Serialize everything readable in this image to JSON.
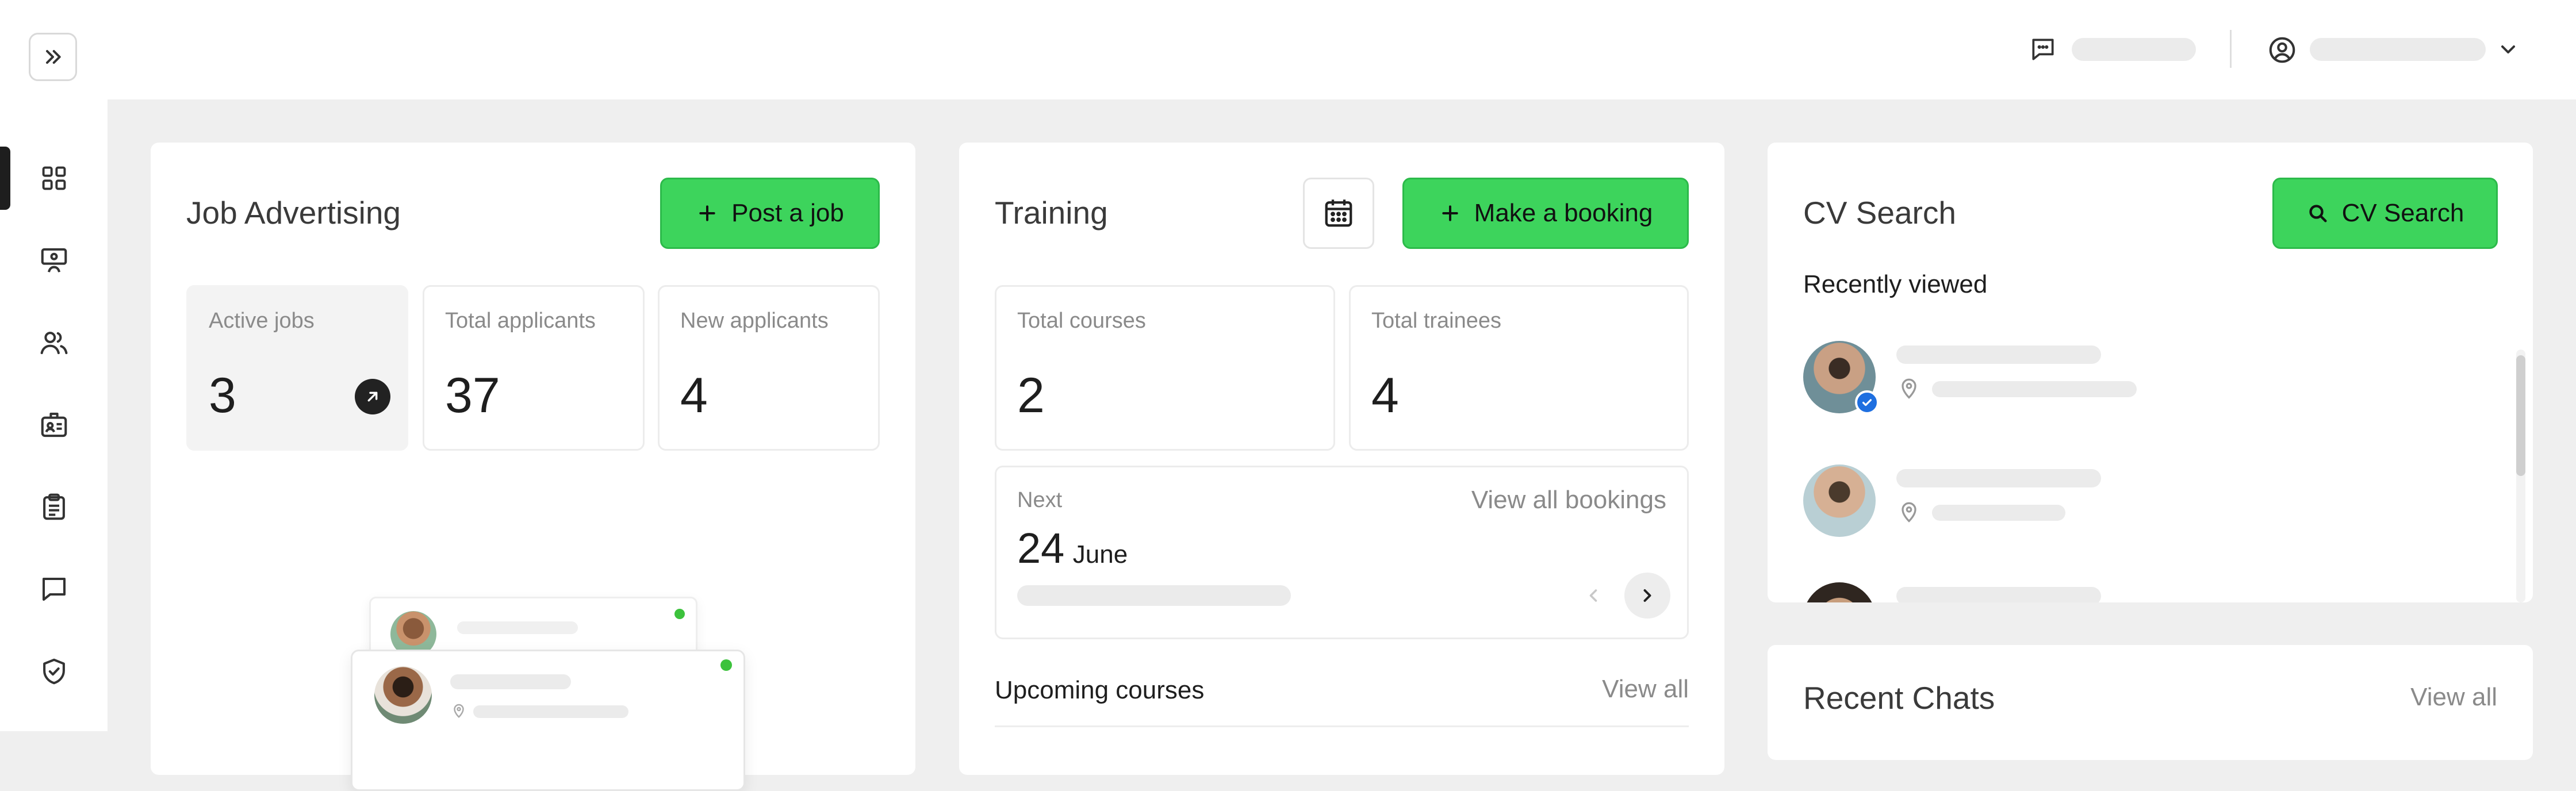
{
  "sidebar": {
    "expand_icon": "chevrons-right-icon",
    "items": [
      {
        "name": "sidebar-item-dashboard",
        "icon": "grid-icon",
        "active": true
      },
      {
        "name": "sidebar-item-training",
        "icon": "presentation-icon"
      },
      {
        "name": "sidebar-item-candidates",
        "icon": "users-icon"
      },
      {
        "name": "sidebar-item-jobs",
        "icon": "id-badge-icon"
      },
      {
        "name": "sidebar-item-tasks",
        "icon": "clipboard-icon"
      },
      {
        "name": "sidebar-item-messages",
        "icon": "chat-icon"
      },
      {
        "name": "sidebar-item-security",
        "icon": "shield-check-icon"
      }
    ]
  },
  "header": {
    "chat_icon": "message-square-icon",
    "user_icon": "user-circle-icon",
    "dropdown_icon": "chevron-down-icon"
  },
  "job_advertising": {
    "title": "Job Advertising",
    "post_job_label": "Post a job",
    "stats": [
      {
        "label": "Active jobs",
        "value": "3"
      },
      {
        "label": "Total applicants",
        "value": "37"
      },
      {
        "label": "New applicants",
        "value": "4"
      }
    ]
  },
  "training": {
    "title": "Training",
    "booking_label": "Make a booking",
    "stats": [
      {
        "label": "Total courses",
        "value": "2"
      },
      {
        "label": "Total trainees",
        "value": "4"
      }
    ],
    "next": {
      "label": "Next",
      "view_all_label": "View all bookings",
      "day": "24",
      "month": "June"
    },
    "upcoming_title": "Upcoming courses",
    "upcoming_view_all": "View all"
  },
  "cv_search": {
    "title": "CV Search",
    "button_label": "CV Search",
    "recently_viewed": "Recently viewed"
  },
  "recent_chats": {
    "title": "Recent Chats",
    "view_all": "View all"
  },
  "colors": {
    "accent_green": "#3dd45c",
    "status_online": "#3cc23c",
    "verified_blue": "#1e6fe0"
  }
}
